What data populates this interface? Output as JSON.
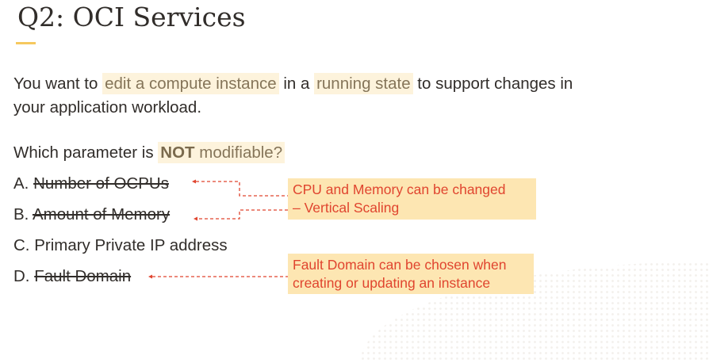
{
  "slide": {
    "title": "Q2:  OCI Services",
    "question": {
      "part1": "You want to ",
      "hl1": "edit a compute instance",
      "part2": " in a ",
      "hl2": "running state",
      "part3": " to support changes in",
      "line2": "your application workload."
    },
    "prompt": {
      "part1": "Which parameter is ",
      "bold": "NOT",
      "rest": " modifiable?"
    },
    "options": [
      {
        "letter": "A. ",
        "text": "Number of OCPUs",
        "struck": true
      },
      {
        "letter": "B. ",
        "text": "Amount of Memory",
        "struck": true
      },
      {
        "letter": "C. ",
        "text": "Primary Private IP address",
        "struck": false
      },
      {
        "letter": "D. ",
        "text": "Fault Domain",
        "struck": true
      }
    ],
    "callouts": [
      {
        "line1": "CPU and Memory can be changed",
        "line2": "– Vertical Scaling"
      },
      {
        "line1": "Fault Domain can be chosen when",
        "line2": "creating or updating an instance"
      }
    ]
  },
  "colors": {
    "accent": "#f6c85f",
    "highlight": "#fdf3dc",
    "callout_bg": "#fde6b2",
    "callout_text": "#e0452f"
  }
}
